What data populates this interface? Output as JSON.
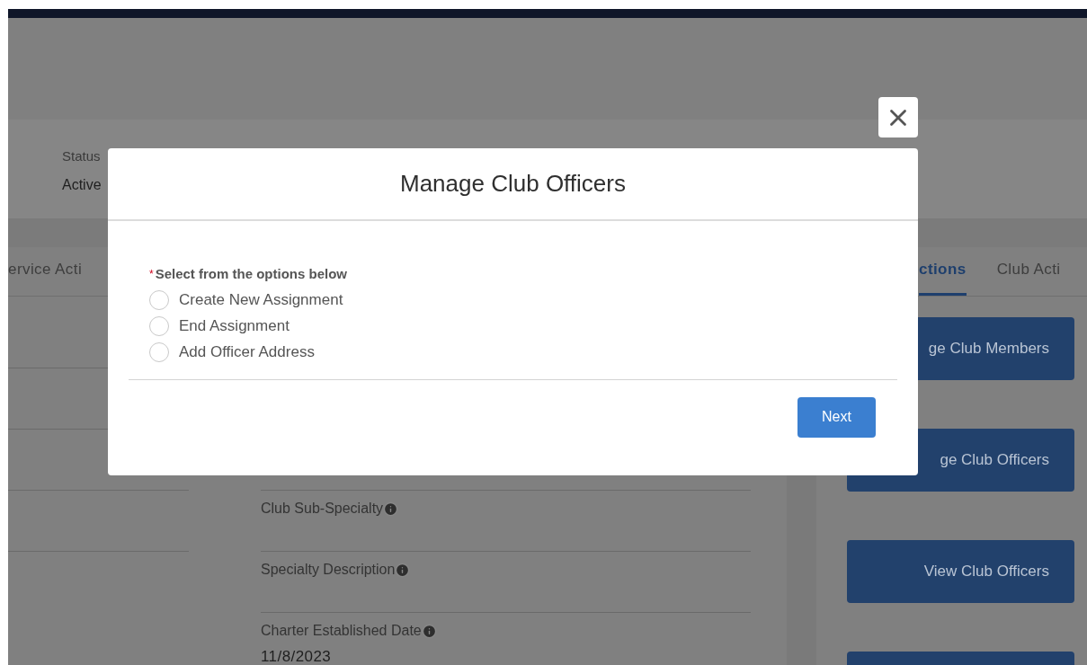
{
  "background": {
    "status_label": "Status",
    "status_value": "Active",
    "left_tab": {
      "label": "ervice Acti",
      "selected": false
    },
    "fields": [
      {
        "label": "Club Sub-Specialty"
      },
      {
        "label": "Specialty Description"
      },
      {
        "label": "Charter Established Date",
        "value": "11/8/2023"
      }
    ],
    "right_tabs": [
      {
        "label": "ctions",
        "selected": true
      },
      {
        "label": "Club Acti",
        "selected": false
      }
    ],
    "action_buttons": [
      "ge Club Members",
      "ge Club Officers",
      "View Club Officers"
    ]
  },
  "modal": {
    "title": "Manage Club Officers",
    "question": {
      "label": "Select from the options below",
      "required_mark": "*",
      "options": [
        {
          "label": "Create New Assignment",
          "selected": false
        },
        {
          "label": "End Assignment",
          "selected": false
        },
        {
          "label": "Add Officer Address",
          "selected": false
        }
      ]
    },
    "next_button": "Next"
  }
}
